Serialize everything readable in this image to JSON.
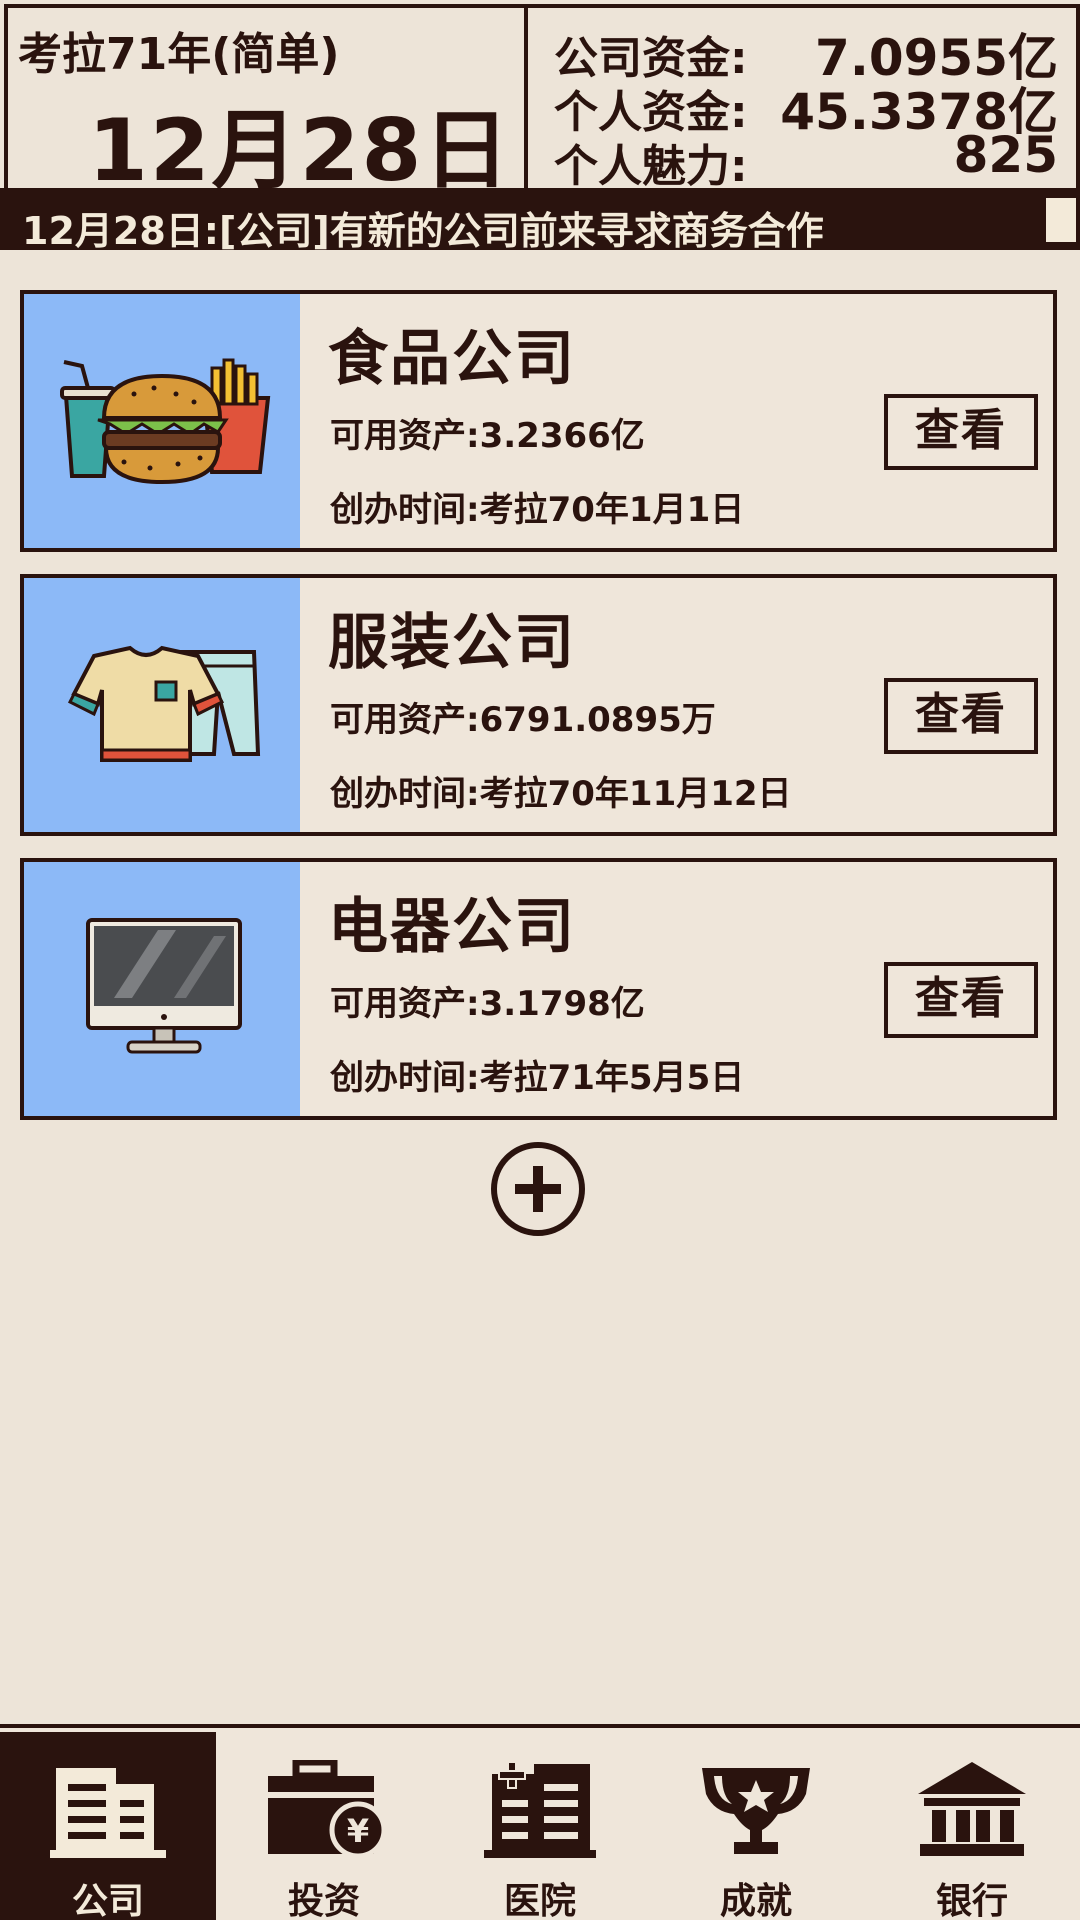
{
  "header": {
    "year": "考拉71年(简单)",
    "date": "12月28日",
    "stats": [
      {
        "label": "公司资金:",
        "value": "7.0955亿"
      },
      {
        "label": "个人资金:",
        "value": "45.3378亿"
      },
      {
        "label": "个人魅力:",
        "value": "825"
      }
    ]
  },
  "ticker": "12月28日:[公司]有新的公司前来寻求商务合作",
  "companies": [
    {
      "name": "食品公司",
      "assets": "可用资产:3.2366亿",
      "founded": "创办时间:考拉70年1月1日",
      "button": "查看",
      "icon": "burger-icon"
    },
    {
      "name": "服装公司",
      "assets": "可用资产:6791.0895万",
      "founded": "创办时间:考拉70年11月12日",
      "button": "查看",
      "icon": "clothes-icon"
    },
    {
      "name": "电器公司",
      "assets": "可用资产:3.1798亿",
      "founded": "创办时间:考拉71年5月5日",
      "button": "查看",
      "icon": "monitor-icon"
    }
  ],
  "nav": [
    {
      "label": "公司",
      "icon": "company-building-icon",
      "active": true
    },
    {
      "label": "投资",
      "icon": "briefcase-yen-icon",
      "active": false
    },
    {
      "label": "医院",
      "icon": "hospital-icon",
      "active": false
    },
    {
      "label": "成就",
      "icon": "trophy-icon",
      "active": false
    },
    {
      "label": "银行",
      "icon": "bank-icon",
      "active": false
    }
  ],
  "colors": {
    "background": "#ede4d8",
    "dark": "#2a130e",
    "card_image_bg": "#8cb9f7"
  }
}
